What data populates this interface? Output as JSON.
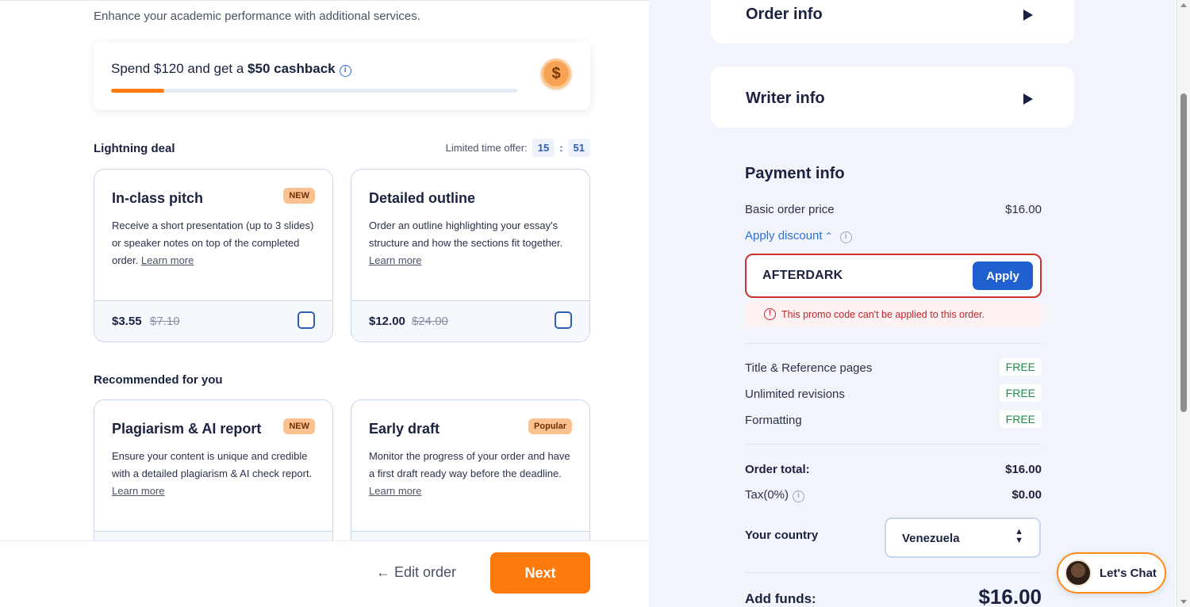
{
  "left": {
    "subtitle": "Enhance your academic performance with additional services.",
    "cashback": {
      "text_prefix": "Spend $120 and get a ",
      "text_bold": "$50 cashback",
      "progress_fraction": 0.13,
      "progress_color": "#ff7a0c",
      "coin_symbol": "$"
    },
    "lightning": {
      "title": "Lightning deal",
      "offer_label": "Limited time offer:",
      "minutes": "15",
      "separator": ":",
      "seconds": "51"
    },
    "lightning_cards": [
      {
        "title": "In-class pitch",
        "badge": "NEW",
        "description": "Receive a short presentation (up to 3 slides) or speaker notes on top of the completed order.",
        "learn_more": "Learn more",
        "price": "$3.55",
        "old_price": "$7.10"
      },
      {
        "title": "Detailed outline",
        "badge": "",
        "description": "Order an outline highlighting your essay's structure and how the sections fit together.",
        "learn_more": "Learn more",
        "price": "$12.00",
        "old_price": "$24.00"
      }
    ],
    "recommended": {
      "title": "Recommended for you"
    },
    "recommended_cards": [
      {
        "title": "Plagiarism & AI report",
        "badge": "NEW",
        "description": "Ensure your content is unique and credible with a detailed plagiarism & AI check report.",
        "learn_more": "Learn more"
      },
      {
        "title": "Early draft",
        "badge": "Popular",
        "description": "Monitor the progress of your order and have a first draft ready way before the deadline.",
        "learn_more": "Learn more"
      }
    ],
    "footer": {
      "edit_order": "Edit order",
      "next": "Next",
      "accent_color": "#ff7a0c"
    }
  },
  "right": {
    "order_info": "Order info",
    "writer_info": "Writer info",
    "payment": {
      "title": "Payment info",
      "basic_label": "Basic order price",
      "basic_value": "$16.00",
      "apply_discount": "Apply discount",
      "promo_code": "AFTERDARK",
      "apply_button": "Apply",
      "error": "This promo code can't be applied to this order.",
      "error_color": "#c0262d",
      "extras": [
        {
          "label": "Title & Reference pages",
          "value": "FREE"
        },
        {
          "label": "Unlimited revisions",
          "value": "FREE"
        },
        {
          "label": "Formatting",
          "value": "FREE"
        }
      ],
      "order_total_label": "Order total:",
      "order_total_value": "$16.00",
      "tax_label": "Tax(0%)",
      "tax_value": "$0.00",
      "country_label": "Your country",
      "country_value": "Venezuela",
      "add_funds_label": "Add funds:",
      "add_funds_value": "$16.00"
    },
    "chat": {
      "label": "Let's Chat"
    }
  }
}
